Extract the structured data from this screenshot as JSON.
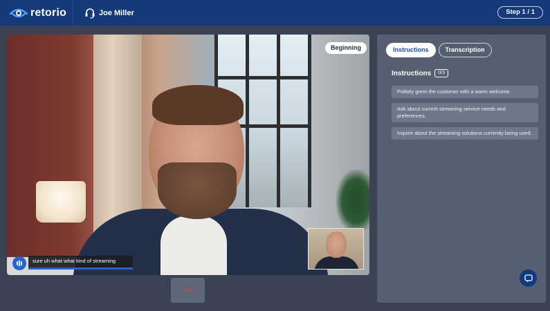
{
  "header": {
    "brand": "retorio",
    "agent_name": "Joe Miller",
    "step_label": "Step 1 / 1"
  },
  "video": {
    "phase_tag": "Beginning",
    "caption": "sure uh what what kind of streaming"
  },
  "panel": {
    "tabs": [
      {
        "label": "Instructions",
        "active": true
      },
      {
        "label": "Transcription",
        "active": false
      }
    ],
    "instructions_title": "Instructions",
    "instructions_count": "0/3",
    "instructions": [
      "Politely greet the customer with a warm welcome.",
      "Ask about current streaming service needs and preferences.",
      "Inquire about the streaming solutions currently being used."
    ]
  },
  "icons": {
    "logo": "retorio-eye-logo",
    "agent": "headset-icon",
    "mic": "audio-wave-icon",
    "hangup": "phone-hangup-icon",
    "chat": "chat-bubble-icon"
  },
  "colors": {
    "header_bg": "#16397a",
    "page_bg": "#3a4254",
    "panel_bg": "#555f70",
    "accent": "#2a63c9",
    "hangup_red": "#d64545"
  }
}
